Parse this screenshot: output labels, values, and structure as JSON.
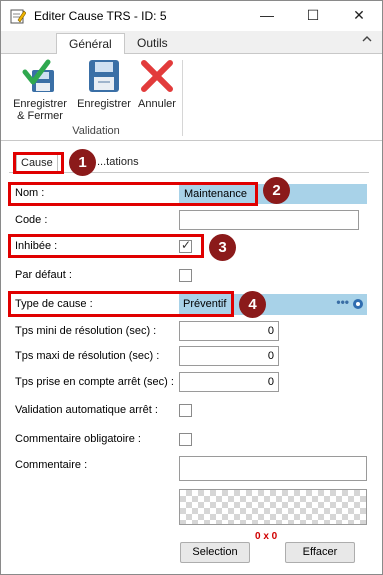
{
  "window": {
    "title": "Editer Cause TRS - ID: 5",
    "controls": {
      "minimize": "—",
      "maximize": "☐",
      "close": "✕"
    }
  },
  "ribbon": {
    "tabs": [
      {
        "label": "Général",
        "active": true
      },
      {
        "label": "Outils",
        "active": false
      }
    ],
    "collapse_icon": "chevron-up-icon",
    "buttons": [
      {
        "label": "Enregistrer\n& Fermer",
        "icon": "save-close-icon"
      },
      {
        "label": "Enregistrer",
        "icon": "floppy-disk-icon"
      },
      {
        "label": "Annuler",
        "icon": "red-x-icon"
      }
    ],
    "group_label": "Validation"
  },
  "content_tabs": [
    {
      "label": "Cause",
      "active": true
    },
    {
      "label": "...tations",
      "active": false
    }
  ],
  "form": {
    "nom": {
      "label": "Nom :",
      "value": "Maintenance"
    },
    "code": {
      "label": "Code :",
      "value": ""
    },
    "inhibee": {
      "label": "Inhibée :",
      "checked": true
    },
    "par_defaut": {
      "label": "Par défaut :",
      "checked": false
    },
    "type_cause": {
      "label": "Type de cause :",
      "value": "Préventif"
    },
    "tps_mini": {
      "label": "Tps mini de résolution (sec) :",
      "value": "0"
    },
    "tps_maxi": {
      "label": "Tps maxi de résolution (sec) :",
      "value": "0"
    },
    "tps_arret": {
      "label": "Tps prise en compte arrêt (sec) :",
      "value": "0"
    },
    "validation_auto": {
      "label": "Validation automatique arrêt :",
      "checked": false
    },
    "commentaire_oblig": {
      "label": "Commentaire obligatoire :",
      "checked": false
    },
    "commentaire": {
      "label": "Commentaire :",
      "value": ""
    },
    "image_dimensions": "0 x 0",
    "selection_button": "Selection",
    "effacer_button": "Effacer"
  },
  "annotations": [
    "1",
    "2",
    "3",
    "4"
  ],
  "colors": {
    "highlight": "#e00000",
    "marker": "#8b1a1a",
    "field_selected": "#a8d2e8"
  }
}
